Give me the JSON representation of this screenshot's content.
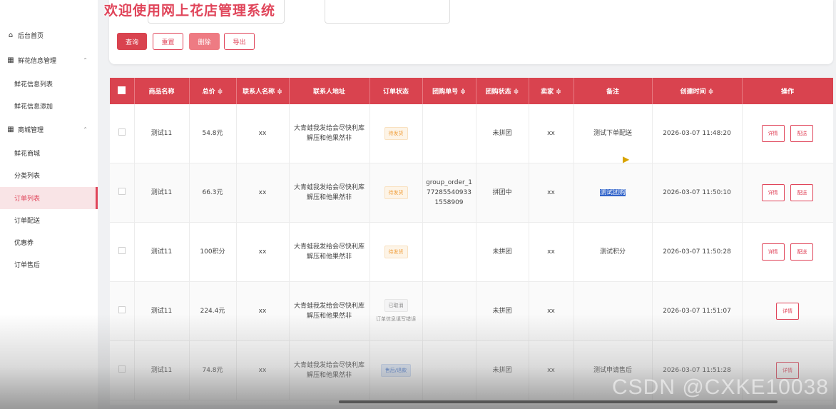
{
  "title": "欢迎使用网上花店管理系统",
  "sidebar": {
    "items": [
      {
        "label": "后台首页",
        "icon": "home-icon"
      },
      {
        "label": "鲜花信息管理",
        "icon": "apps-icon",
        "expanded": true
      },
      {
        "label": "鲜花信息列表"
      },
      {
        "label": "鲜花信息添加"
      },
      {
        "label": "商城管理",
        "icon": "apps-icon",
        "expanded": true
      },
      {
        "label": "鲜花商城"
      },
      {
        "label": "分类列表"
      },
      {
        "label": "订单列表",
        "active": true
      },
      {
        "label": "订单配送"
      },
      {
        "label": "优惠券"
      },
      {
        "label": "订单售后"
      }
    ]
  },
  "toolbar": {
    "query_label": "查询",
    "reset_label": "重置",
    "delete_label": "删除",
    "export_label": "导出"
  },
  "table": {
    "headers": {
      "name": "商品名称",
      "total": "总价 ≑",
      "contact": "联系人名称 ≑",
      "address": "联系人地址",
      "status": "订单状态",
      "group_no": "团购单号 ≑",
      "group_status": "团购状态 ≑",
      "seller": "卖家 ≑",
      "remark": "备注",
      "created": "创建时间 ≑",
      "ops": "操作"
    },
    "rows": [
      {
        "name": "测试11",
        "total": "54.8元",
        "contact": "xx",
        "address": "大青蛙我发给会尽快利库解压和他果然非",
        "status": "待发货",
        "status_note": "",
        "group_no": "",
        "group_status": "未拼团",
        "seller": "xx",
        "remark": "测试下单配送",
        "created": "2026-03-07 11:48:20",
        "detail": "详情",
        "deliver": "配送"
      },
      {
        "name": "测试11",
        "total": "66.3元",
        "contact": "xx",
        "address": "大青蛙我发给会尽快利库解压和他果然非",
        "status": "待发货",
        "status_note": "",
        "group_no": "group_order_1772855409331558909",
        "group_status": "拼团中",
        "seller": "xx",
        "remark": "测试团购",
        "created": "2026-03-07 11:50:10",
        "detail": "详情",
        "deliver": "配送"
      },
      {
        "name": "测试11",
        "total": "100积分",
        "contact": "xx",
        "address": "大青蛙我发给会尽快利库解压和他果然非",
        "status": "待发货",
        "status_note": "",
        "group_no": "",
        "group_status": "未拼团",
        "seller": "xx",
        "remark": "测试积分",
        "created": "2026-03-07 11:50:28",
        "detail": "详情",
        "deliver": "配送"
      },
      {
        "name": "测试11",
        "total": "224.4元",
        "contact": "xx",
        "address": "大青蛙我发给会尽快利库解压和他果然非",
        "status": "已取消",
        "status_note": "订单信息填写错误",
        "group_no": "",
        "group_status": "未拼团",
        "seller": "xx",
        "remark": "",
        "created": "2026-03-07 11:51:07",
        "detail": "详情",
        "deliver": ""
      },
      {
        "name": "测试11",
        "total": "74.8元",
        "contact": "xx",
        "address": "大青蛙我发给会尽快利库解压和他果然非",
        "status": "售后/退款",
        "status_note": "",
        "group_no": "",
        "group_status": "未拼团",
        "seller": "xx",
        "remark": "测试申请售后",
        "created": "2026-03-07 11:51:28",
        "detail": "详情",
        "deliver": ""
      }
    ]
  },
  "watermark": "CSDN @CXKE10038",
  "colors": {
    "accent": "#d9434f",
    "accent_light": "#ee7b83",
    "active_bg": "#f9e4e6"
  }
}
